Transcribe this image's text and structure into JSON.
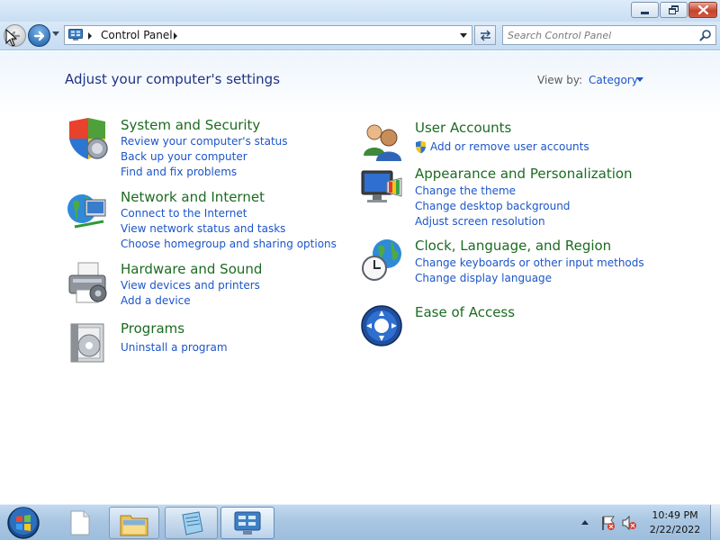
{
  "window": {
    "minimize_icon": "minimize-icon",
    "maximize_icon": "restore-icon",
    "close_icon": "close-icon"
  },
  "nav": {
    "back_icon": "back-arrow-icon",
    "forward_icon": "forward-arrow-icon",
    "address": {
      "icon": "control-panel-icon",
      "breadcrumb": [
        "Control Panel"
      ]
    },
    "search": {
      "placeholder": "Search Control Panel",
      "value": ""
    }
  },
  "main": {
    "heading": "Adjust your computer's settings",
    "view_by_label": "View by:",
    "view_by_value": "Category",
    "categories_left": [
      {
        "title": "System and Security",
        "icon": "shield-icon",
        "links": [
          "Review your computer's status",
          "Back up your computer",
          "Find and fix problems"
        ]
      },
      {
        "title": "Network and Internet",
        "icon": "globe-network-icon",
        "links": [
          "Connect to the Internet",
          "View network status and tasks",
          "Choose homegroup and sharing options"
        ]
      },
      {
        "title": "Hardware and Sound",
        "icon": "printer-icon",
        "links": [
          "View devices and printers",
          "Add a device"
        ]
      },
      {
        "title": "Programs",
        "icon": "programs-icon",
        "links": [
          "Uninstall a program"
        ]
      }
    ],
    "categories_right": [
      {
        "title": "User Accounts",
        "icon": "users-icon",
        "links": [
          "Add or remove user accounts"
        ]
      },
      {
        "title": "Appearance and Personalization",
        "icon": "monitor-palette-icon",
        "links": [
          "Change the theme",
          "Change desktop background",
          "Adjust screen resolution"
        ]
      },
      {
        "title": "Clock, Language, and Region",
        "icon": "globe-clock-icon",
        "links": [
          "Change keyboards or other input methods",
          "Change display language"
        ]
      },
      {
        "title": "Ease of Access",
        "icon": "ease-of-access-icon",
        "links": []
      }
    ]
  },
  "taskbar": {
    "items": [
      "start-orb-icon",
      "blank-document-icon",
      "file-explorer-icon",
      "notepad-icon",
      "control-panel-icon"
    ],
    "time": "10:49 PM",
    "date": "2/22/2022"
  }
}
